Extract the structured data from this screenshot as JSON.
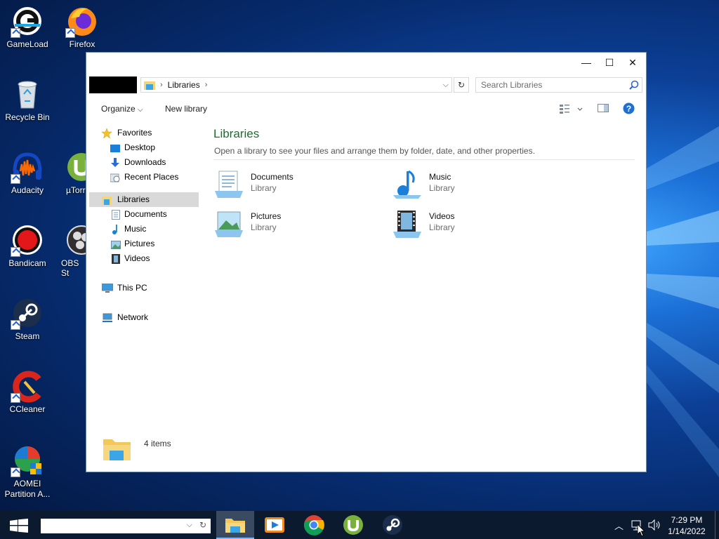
{
  "desktop": {
    "icons": [
      {
        "label": "GameLoad"
      },
      {
        "label": "Firefox"
      },
      {
        "label": "Recycle Bin"
      },
      {
        "label": "Audacity"
      },
      {
        "label": "µTorr"
      },
      {
        "label": "Bandicam"
      },
      {
        "label": "OBS St"
      },
      {
        "label": "Steam"
      },
      {
        "label": "CCleaner"
      },
      {
        "label": "AOMEI Partition A..."
      }
    ]
  },
  "window": {
    "title_buttons": {
      "minimize": "—",
      "maximize": "☐",
      "close": "✕"
    },
    "address": {
      "crumb": "Libraries"
    },
    "search": {
      "placeholder": "Search Libraries"
    },
    "commands": {
      "organize": "Organize",
      "new_library": "New library"
    },
    "nav": {
      "favorites": "Favorites",
      "desktop": "Desktop",
      "downloads": "Downloads",
      "recent": "Recent Places",
      "libraries": "Libraries",
      "documents": "Documents",
      "music": "Music",
      "pictures": "Pictures",
      "videos": "Videos",
      "this_pc": "This PC",
      "network": "Network"
    },
    "content": {
      "title": "Libraries",
      "description": "Open a library to see your files and arrange them by folder, date, and other properties.",
      "tiles": [
        {
          "name": "Documents",
          "type": "Library"
        },
        {
          "name": "Music",
          "type": "Library"
        },
        {
          "name": "Pictures",
          "type": "Library"
        },
        {
          "name": "Videos",
          "type": "Library"
        }
      ]
    },
    "status": {
      "count": "4 items"
    }
  },
  "taskbar": {
    "clock_time": "7:29 PM",
    "clock_date": "1/14/2022",
    "apps": [
      "File Explorer",
      "Media Player",
      "Chrome",
      "uTorrent",
      "Steam"
    ]
  },
  "colors": {
    "accent_green": "#1a6e2e",
    "taskbar": "#0c1a30",
    "help_blue": "#1f6fd1"
  }
}
